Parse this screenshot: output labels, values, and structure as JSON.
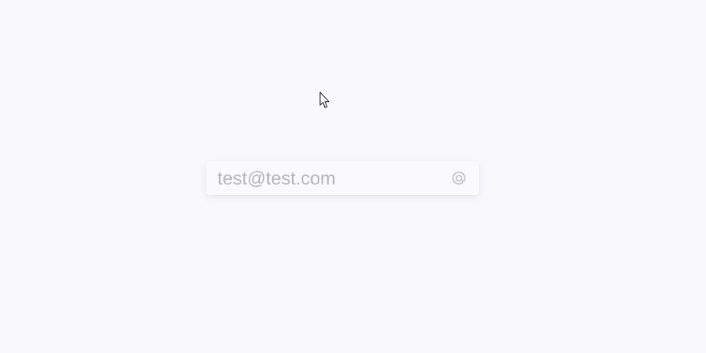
{
  "email_field": {
    "placeholder": "test@test.com"
  },
  "icons": {
    "at": "at-sign-icon",
    "cursor": "mouse-pointer-icon"
  },
  "colors": {
    "background": "#f9f9fc",
    "placeholder_text": "#b4b4bd",
    "icon": "#c2c2ca"
  }
}
